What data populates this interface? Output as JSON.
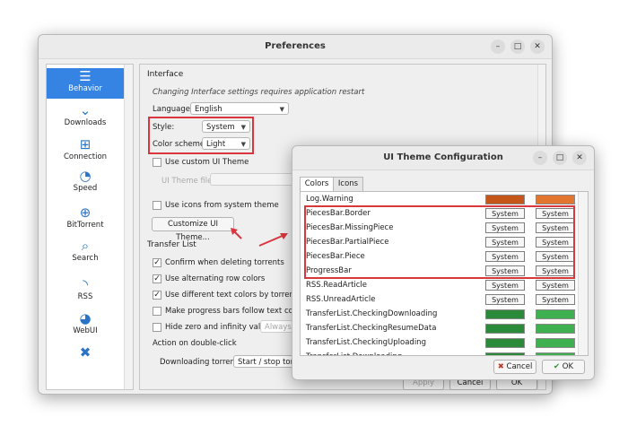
{
  "prefs": {
    "title": "Preferences",
    "controls": {
      "minimize": "–",
      "maximize": "□",
      "close": "✕"
    },
    "sidebar": [
      {
        "label": "Behavior",
        "icon": "sliders-icon",
        "glyph": "☰"
      },
      {
        "label": "Downloads",
        "icon": "chevrons-down-icon",
        "glyph": "⌄"
      },
      {
        "label": "Connection",
        "icon": "network-icon",
        "glyph": "⊞"
      },
      {
        "label": "Speed",
        "icon": "speedometer-icon",
        "glyph": "◔"
      },
      {
        "label": "BitTorrent",
        "icon": "globe-icon",
        "glyph": "⊕"
      },
      {
        "label": "Search",
        "icon": "search-icon",
        "glyph": "⌕"
      },
      {
        "label": "RSS",
        "icon": "rss-icon",
        "glyph": "◝"
      },
      {
        "label": "WebUI",
        "icon": "satellite-icon",
        "glyph": "◕"
      },
      {
        "label": "",
        "icon": "tools-icon",
        "glyph": "✖"
      }
    ],
    "interface": {
      "group": "Interface",
      "note": "Changing Interface settings requires application restart",
      "language_label": "Language:",
      "language_value": "English",
      "style_label": "Style:",
      "style_value": "System",
      "scheme_label": "Color scheme:",
      "scheme_value": "Light",
      "use_custom_theme": "Use custom UI Theme",
      "theme_file_label": "UI Theme file:",
      "use_system_icons": "Use icons from system theme",
      "customize_button": "Customize UI Theme..."
    },
    "transfer": {
      "group": "Transfer List",
      "confirm_delete": "Confirm when deleting torrents",
      "alt_rows": "Use alternating row colors",
      "diff_text": "Use different text colors by torrent states",
      "progress_follow": "Make progress bars follow text colors",
      "hide_zero": "Hide zero and infinity values",
      "hide_zero_value": "Always",
      "double_click": "Action on double-click",
      "downloading_label": "Downloading torrents:",
      "downloading_value": "Start / stop torrent"
    },
    "footer": {
      "apply": "Apply",
      "cancel": "Cancel",
      "ok": "OK"
    }
  },
  "theme": {
    "title": "UI Theme Configuration",
    "tabs": [
      "Colors",
      "Icons"
    ],
    "system_label": "System",
    "rows": [
      {
        "name": "Log.Warning",
        "c1": "#c4561a",
        "c2": "#e2762e"
      },
      {
        "name": "PiecesBar.Border"
      },
      {
        "name": "PiecesBar.MissingPiece"
      },
      {
        "name": "PiecesBar.PartialPiece"
      },
      {
        "name": "PiecesBar.Piece"
      },
      {
        "name": "ProgressBar"
      },
      {
        "name": "RSS.ReadArticle"
      },
      {
        "name": "RSS.UnreadArticle"
      },
      {
        "name": "TransferList.CheckingDownloading",
        "c1": "#2a8a3a",
        "c2": "#3fb04f"
      },
      {
        "name": "TransferList.CheckingResumeData",
        "c1": "#2a8a3a",
        "c2": "#3fb04f"
      },
      {
        "name": "TransferList.CheckingUploading",
        "c1": "#2a8a3a",
        "c2": "#3fb04f"
      },
      {
        "name": "TransferList.Downloading",
        "c1": "#2a8a3a",
        "c2": "#3fb04f"
      }
    ],
    "cancel": "Cancel",
    "ok": "OK"
  },
  "colors": {
    "accent": "#3584e4",
    "highlight": "#d9363e"
  }
}
